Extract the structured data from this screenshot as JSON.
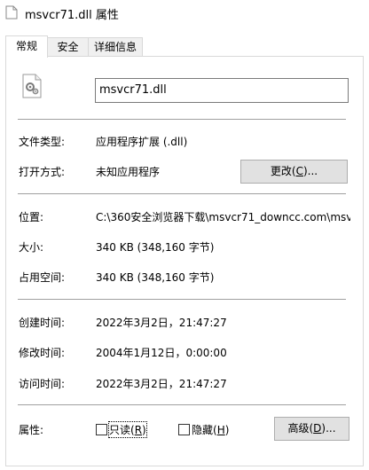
{
  "window": {
    "title": "msvcr71.dll 属性"
  },
  "tabs": [
    {
      "label": "常规",
      "active": true
    },
    {
      "label": "安全",
      "active": false
    },
    {
      "label": "详细信息",
      "active": false
    }
  ],
  "file": {
    "name": "msvcr71.dll",
    "icon": "dll-settings-file-icon"
  },
  "general": {
    "type_label": "文件类型:",
    "type_value": "应用程序扩展 (.dll)",
    "open_with_label": "打开方式:",
    "open_with_value": "未知应用程序",
    "change_button": {
      "prefix": "更改(",
      "accel": "C",
      "suffix": ")..."
    },
    "location_label": "位置:",
    "location_value": "C:\\360安全浏览器下载\\msvcr71_downcc.com\\msvc",
    "size_label": "大小:",
    "size_value": "340 KB (348,160 字节)",
    "disk_size_label": "占用空间:",
    "disk_size_value": "340 KB (348,160 字节)",
    "created_label": "创建时间:",
    "created_value": "2022年3月2日，21:47:27",
    "modified_label": "修改时间:",
    "modified_value": "2004年1月12日，0:00:00",
    "accessed_label": "访问时间:",
    "accessed_value": "2022年3月2日，21:47:27",
    "attributes_label": "属性:",
    "readonly": {
      "prefix": "只读(",
      "accel": "R",
      "suffix": ")",
      "checked": false
    },
    "hidden": {
      "prefix": "隐藏(",
      "accel": "H",
      "suffix": ")",
      "checked": false
    },
    "advanced_button": {
      "prefix": "高级(",
      "accel": "D",
      "suffix": ")..."
    }
  },
  "colors": {
    "button_face": "#e1e1e1",
    "button_border": "#adadad",
    "separator": "#a0a0a0"
  }
}
